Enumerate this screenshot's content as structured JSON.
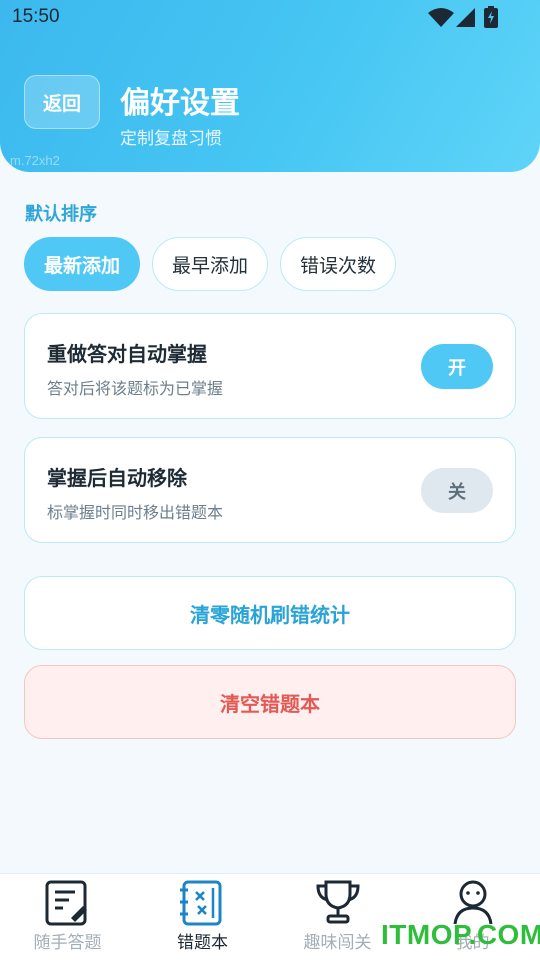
{
  "status": {
    "time": "15:50"
  },
  "header": {
    "back_label": "返回",
    "title": "偏好设置",
    "subtitle": "定制复盘习惯",
    "watermark": "m.72xh2"
  },
  "sort": {
    "label": "默认排序",
    "options": [
      "最新添加",
      "最早添加",
      "错误次数"
    ],
    "selected": "最新添加"
  },
  "settings": [
    {
      "title": "重做答对自动掌握",
      "desc": "答对后将该题标为已掌握",
      "toggle": "开",
      "on": true
    },
    {
      "title": "掌握后自动移除",
      "desc": "标掌握时同时移出错题本",
      "toggle": "关",
      "on": false
    }
  ],
  "actions": {
    "reset_stats": "清零随机刷错统计",
    "clear_book": "清空错题本"
  },
  "tabs": [
    {
      "label": "随手答题",
      "icon": "note-edit-icon",
      "active": false
    },
    {
      "label": "错题本",
      "icon": "wrong-book-icon",
      "active": true
    },
    {
      "label": "趣味闯关",
      "icon": "trophy-icon",
      "active": false
    },
    {
      "label": "我的",
      "icon": "user-icon",
      "active": false
    }
  ],
  "watermark_brand": "ITMOP.COM",
  "colors": {
    "accent": "#4fc8f5",
    "danger": "#e35a55",
    "active_tab": "#1c2833"
  }
}
